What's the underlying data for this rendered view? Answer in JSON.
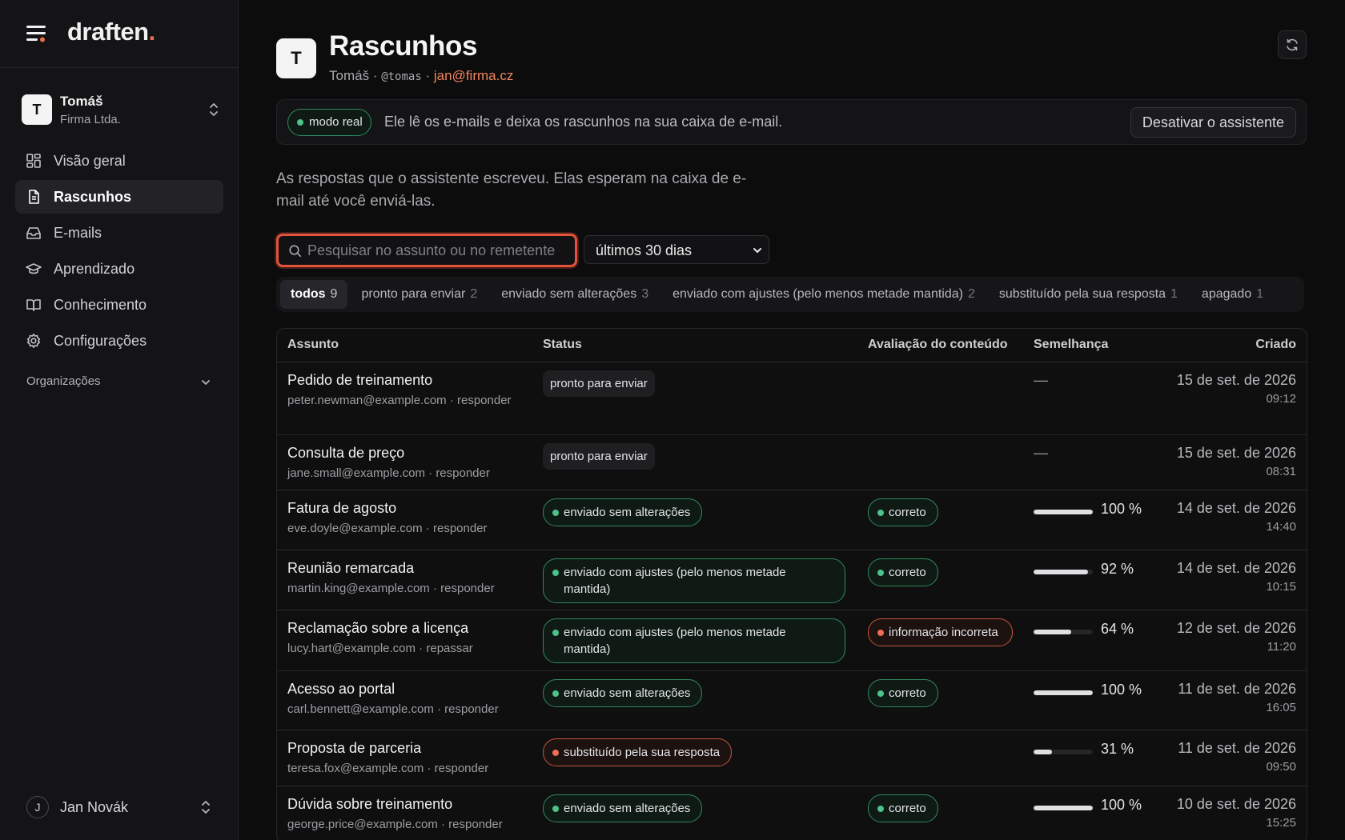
{
  "app": {
    "brand": "draften",
    "brand_dot": "."
  },
  "workspace": {
    "avatar": "T",
    "name": "Tomáš",
    "org": "Firma Ltda."
  },
  "nav": [
    {
      "label": "Visão geral",
      "icon": "grid-icon",
      "active": false
    },
    {
      "label": "Rascunhos",
      "icon": "document-icon",
      "active": true
    },
    {
      "label": "E-mails",
      "icon": "inbox-icon",
      "active": false
    },
    {
      "label": "Aprendizado",
      "icon": "graduation-cap-icon",
      "active": false
    },
    {
      "label": "Conhecimento",
      "icon": "book-icon",
      "active": false
    },
    {
      "label": "Configurações",
      "icon": "gear-icon",
      "active": false
    }
  ],
  "organizations_label": "Organizações",
  "user": {
    "avatar": "J",
    "name": "Jan Novák"
  },
  "page": {
    "avatar": "T",
    "title": "Rascunhos",
    "owner": "Tomáš",
    "handle": "@tomas",
    "email": "jan@firma.cz",
    "separator": " · "
  },
  "banner": {
    "mode": "modo real",
    "text": "Ele lê os e-mails e deixa os rascunhos na sua caixa de e-mail.",
    "deactivate": "Desativar o assistente"
  },
  "intro": "As respostas que o assistente escreveu. Elas esperam na caixa de e-mail até você enviá-las.",
  "search": {
    "placeholder": "Pesquisar no assunto ou no remetente",
    "value": ""
  },
  "range": {
    "selected": "últimos 30 dias"
  },
  "filters": [
    {
      "label": "todos",
      "count": "9",
      "active": true
    },
    {
      "label": "pronto para enviar",
      "count": "2",
      "active": false
    },
    {
      "label": "enviado sem alterações",
      "count": "3",
      "active": false
    },
    {
      "label": "enviado com ajustes (pelo menos metade mantida)",
      "count": "2",
      "active": false
    },
    {
      "label": "substituído pela sua resposta",
      "count": "1",
      "active": false
    },
    {
      "label": "apagado",
      "count": "1",
      "active": false
    }
  ],
  "table": {
    "headers": {
      "subject": "Assunto",
      "status": "Status",
      "evaluation": "Avaliação do conteúdo",
      "similarity": "Semelhança",
      "created": "Criado"
    },
    "rows": [
      {
        "subject": "Pedido de treinamento",
        "sender": "peter.newman@example.com",
        "action": "responder",
        "status": "pronto para enviar",
        "status_kind": "plain",
        "evaluation": "",
        "evaluation_kind": "",
        "similarity": null,
        "similarity_text": "—",
        "date": "15 de set. de 2026",
        "time": "09:12"
      },
      {
        "subject": "Consulta de preço",
        "sender": "jane.small@example.com",
        "action": "responder",
        "status": "pronto para enviar",
        "status_kind": "plain",
        "evaluation": "",
        "evaluation_kind": "",
        "similarity": null,
        "similarity_text": "—",
        "date": "15 de set. de 2026",
        "time": "08:31"
      },
      {
        "subject": "Fatura de agosto",
        "sender": "eve.doyle@example.com",
        "action": "responder",
        "status": "enviado sem alterações",
        "status_kind": "green",
        "evaluation": "correto",
        "evaluation_kind": "green",
        "similarity": 100,
        "similarity_text": "100 %",
        "date": "14 de set. de 2026",
        "time": "14:40"
      },
      {
        "subject": "Reunião remarcada",
        "sender": "martin.king@example.com",
        "action": "responder",
        "status": "enviado com ajustes (pelo menos metade mantida)",
        "status_kind": "green-wide",
        "evaluation": "correto",
        "evaluation_kind": "green",
        "similarity": 92,
        "similarity_text": "92 %",
        "date": "14 de set. de 2026",
        "time": "10:15"
      },
      {
        "subject": "Reclamação sobre a licença",
        "sender": "lucy.hart@example.com",
        "action": "repassar",
        "status": "enviado com ajustes (pelo menos metade mantida)",
        "status_kind": "green-wide",
        "evaluation": "informação incorreta",
        "evaluation_kind": "red-mid",
        "similarity": 64,
        "similarity_text": "64 %",
        "date": "12 de set. de 2026",
        "time": "11:20"
      },
      {
        "subject": "Acesso ao portal",
        "sender": "carl.bennett@example.com",
        "action": "responder",
        "status": "enviado sem alterações",
        "status_kind": "green",
        "evaluation": "correto",
        "evaluation_kind": "green",
        "similarity": 100,
        "similarity_text": "100 %",
        "date": "11 de set. de 2026",
        "time": "16:05"
      },
      {
        "subject": "Proposta de parceria",
        "sender": "teresa.fox@example.com",
        "action": "responder",
        "status": "substituído pela sua resposta",
        "status_kind": "red",
        "evaluation": "",
        "evaluation_kind": "",
        "similarity": 31,
        "similarity_text": "31 %",
        "date": "11 de set. de 2026",
        "time": "09:50"
      },
      {
        "subject": "Dúvida sobre treinamento",
        "sender": "george.price@example.com",
        "action": "responder",
        "status": "enviado sem alterações",
        "status_kind": "green",
        "evaluation": "correto",
        "evaluation_kind": "green",
        "similarity": 100,
        "similarity_text": "100 %",
        "date": "10 de set. de 2026",
        "time": "15:25"
      }
    ]
  },
  "colors": {
    "accent": "#e2533a",
    "email": "#f2845f",
    "ok": "#4cc38a",
    "warn": "#ef6c55",
    "bg": "#0c0c0d"
  }
}
